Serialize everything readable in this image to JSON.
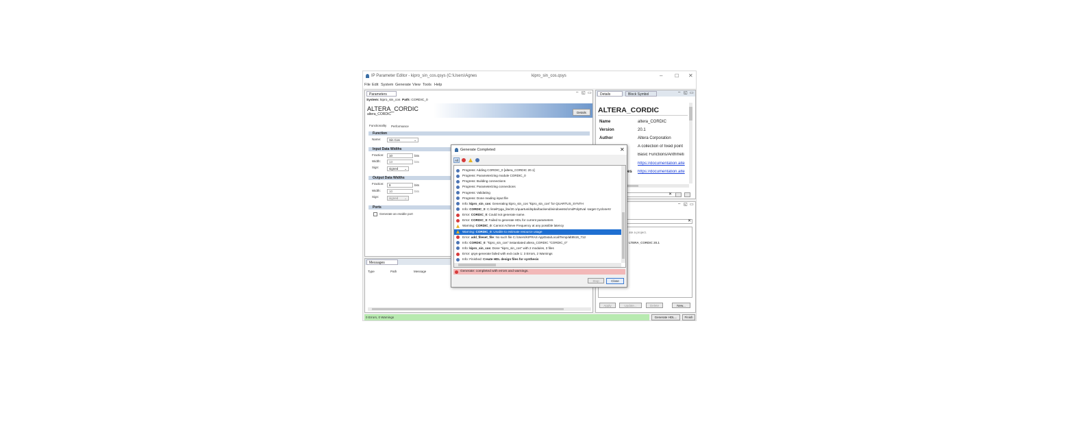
{
  "window": {
    "title": "IP Parameter Editor - kipro_sin_cos.qsys (C:\\Users\\Agnes",
    "center_title": "kipro_sin_cos.qsys",
    "menu": [
      "File",
      "Edit",
      "System",
      "Generate",
      "View",
      "Tools",
      "Help"
    ]
  },
  "params_panel": {
    "tab": "Parameters",
    "system_label": "System:",
    "system_value": "kipro_sin_cos",
    "path_label": "Path:",
    "path_value": "CORDIC_0",
    "ip_title": "ALTERA_CORDIC",
    "ip_subtitle": "altera_CORDIC",
    "details_button": "Details",
    "tabs": [
      "Functionality",
      "Performance"
    ],
    "function_section": "Function",
    "name_label": "Name:",
    "name_value": "Sin Cos",
    "input_section": "Input Data Widths",
    "input_fraction_label": "Fraction:",
    "input_fraction_value": "10",
    "input_fraction_unit": "bits",
    "input_width_label": "Width:",
    "input_width_value": "13",
    "input_width_unit": "bits",
    "input_sign_label": "Sign:",
    "input_sign_value": "signed",
    "output_section": "Output Data Widths",
    "output_fraction_label": "Fraction:",
    "output_fraction_value": "8",
    "output_fraction_unit": "bits",
    "output_width_label": "Width:",
    "output_width_value": "10",
    "output_width_unit": "bits",
    "output_sign_label": "Sign:",
    "output_sign_value": "signed",
    "ports_section": "Ports",
    "enable_port_label": "Generate an enable port"
  },
  "messages_panel": {
    "tab": "Messages",
    "columns": [
      "Type",
      "Path",
      "Message"
    ]
  },
  "details_panel": {
    "tabs": [
      "Details",
      "Block Symbol"
    ],
    "title": "ALTERA_CORDIC",
    "rows": [
      {
        "key": "Name",
        "value": "altera_CORDIC"
      },
      {
        "key": "Version",
        "value": "20.1"
      },
      {
        "key": "Author",
        "value": "Altera Corporation"
      },
      {
        "key": "",
        "value": "A collection of fixed point"
      },
      {
        "key": "",
        "value": "Basic Functions/Arithmeti"
      },
      {
        "key": "",
        "value": "https://documentation.alte"
      },
      {
        "key": "es",
        "value": "https://documentation.alte"
      }
    ]
  },
  "presets_panel": {
    "hint": "ate a project.",
    "preset_text": "LTERA_CORDIC 20.1",
    "buttons": [
      "Apply",
      "Update...",
      "Delete",
      "New..."
    ]
  },
  "status_bar": {
    "text": "0 Errors, 0 Warnings",
    "generate_button": "Generate HDL...",
    "finish_button": "Finish"
  },
  "dialog": {
    "title": "Generate Completed",
    "filter_all": "All",
    "messages": [
      {
        "type": "info",
        "pre": "Progress: Adding CORDIC_0 [altera_CORDIC 20.1]",
        "b": "",
        "post": ""
      },
      {
        "type": "info",
        "pre": "Progress: Parameterizing module CORDIC_0",
        "b": "",
        "post": ""
      },
      {
        "type": "info",
        "pre": "Progress: Building connections",
        "b": "",
        "post": ""
      },
      {
        "type": "info",
        "pre": "Progress: Parameterizing connections",
        "b": "",
        "post": ""
      },
      {
        "type": "info",
        "pre": "Progress: Validating",
        "b": "",
        "post": ""
      },
      {
        "type": "info",
        "pre": "Progress: Done reading input file",
        "b": "",
        "post": ""
      },
      {
        "type": "info",
        "pre": "Info: ",
        "b": "kipro_sin_cos",
        "post": ": Generating kipro_sin_cos \"kipro_sin_cos\" for QUARTUS_SYNTH"
      },
      {
        "type": "info",
        "pre": "Info: ",
        "b": "CORDIC_0",
        "post": ": C:/intelFpga_lite/20.1/quartus/dspba/backend/windows64/cmdPolyEval -target CycloneIV"
      },
      {
        "type": "err",
        "pre": "Error: ",
        "b": "CORDIC_0",
        "post": ": Could not generate name."
      },
      {
        "type": "err",
        "pre": "Error: ",
        "b": "CORDIC_0",
        "post": ": Failed to generate HDL for current parameters"
      },
      {
        "type": "warn",
        "pre": "Warning: ",
        "b": "CORDIC_0",
        "post": ": Cannot Achieve Frequency at any possible latency"
      },
      {
        "type": "warn",
        "pre": "Warning: ",
        "b": "CORDIC_0",
        "post": ": Unable to estimate resource usage",
        "sel": true
      },
      {
        "type": "err",
        "pre": "Error: ",
        "b": "add_fileset_file",
        "post": ": No such file C:/Users/KIPRAS            AppData/Local/Temp/alt8519_712"
      },
      {
        "type": "info",
        "pre": "Info: ",
        "b": "CORDIC_0",
        "post": ": \"kipro_sin_cos\" instantiated altera_CORDIC \"CORDIC_0\""
      },
      {
        "type": "info",
        "pre": "Info: ",
        "b": "kipro_sin_cos",
        "post": ": Done \"kipro_sin_cos\" with 2 modules, 3 files"
      },
      {
        "type": "err",
        "pre": "Error: qsys-generate failed with exit code 1: 3 Errors, 2 Warnings",
        "b": "",
        "post": ""
      },
      {
        "type": "info",
        "pre": "Info: Finished: ",
        "b": "Create HDL design files for synthesis",
        "post": ""
      }
    ],
    "status": "Generate: completed with errors and warnings.",
    "stop_button": "Stop",
    "close_button": "Close"
  }
}
